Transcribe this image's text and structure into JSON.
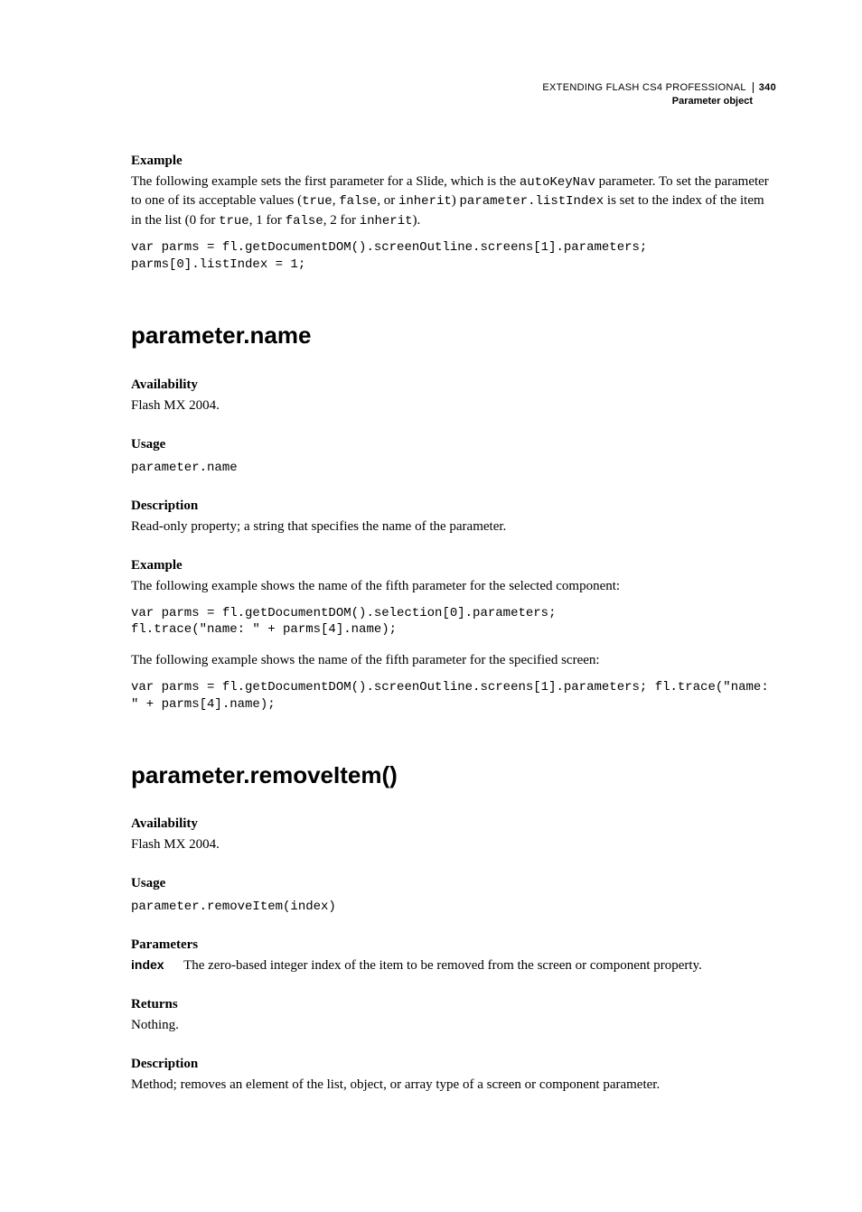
{
  "header": {
    "book_title": "EXTENDING FLASH CS4 PROFESSIONAL",
    "chapter": "Parameter object",
    "page_number": "340"
  },
  "s0": {
    "h_example": "Example",
    "p1a": "The following example sets the first parameter for a Slide, which is the ",
    "p1_code1": "autoKeyNav",
    "p1b": " parameter. To set the parameter to one of its acceptable values (",
    "p1_code2": "true",
    "p1c": ", ",
    "p1_code3": "false",
    "p1d": ", or ",
    "p1_code4": "inherit",
    "p1e": ") ",
    "p1_code5": "parameter.listIndex",
    "p1f": " is set to the index of the item in the list (0 for ",
    "p1_code6": "true",
    "p1g": ", 1 for ",
    "p1_code7": "false",
    "p1h": ", 2 for ",
    "p1_code8": "inherit",
    "p1i": ").",
    "code": "var parms = fl.getDocumentDOM().screenOutline.screens[1].parameters; \nparms[0].listIndex = 1;"
  },
  "s1": {
    "title": "parameter.name",
    "h_avail": "Availability",
    "avail_text": "Flash MX 2004.",
    "h_usage": "Usage",
    "usage_code": "parameter.name",
    "h_desc": "Description",
    "desc_text": "Read-only property; a string that specifies the name of the parameter.",
    "h_example": "Example",
    "ex_p1": "The following example shows the name of the fifth parameter for the selected component:",
    "ex_code1": "var parms = fl.getDocumentDOM().selection[0].parameters; \nfl.trace(\"name: \" + parms[4].name);",
    "ex_p2": "The following example shows the name of the fifth parameter for the specified screen:",
    "ex_code2": "var parms = fl.getDocumentDOM().screenOutline.screens[1].parameters; fl.trace(\"name: \" + parms[4].name);"
  },
  "s2": {
    "title": "parameter.removeItem()",
    "h_avail": "Availability",
    "avail_text": "Flash MX 2004.",
    "h_usage": "Usage",
    "usage_code": "parameter.removeItem(index)",
    "h_params": "Parameters",
    "param_name": "index",
    "param_desc": "The zero-based integer index of the item to be removed from the screen or component property.",
    "h_returns": "Returns",
    "returns_text": "Nothing.",
    "h_desc": "Description",
    "desc_text": "Method; removes an element of the list, object, or array type of a screen or component parameter."
  }
}
